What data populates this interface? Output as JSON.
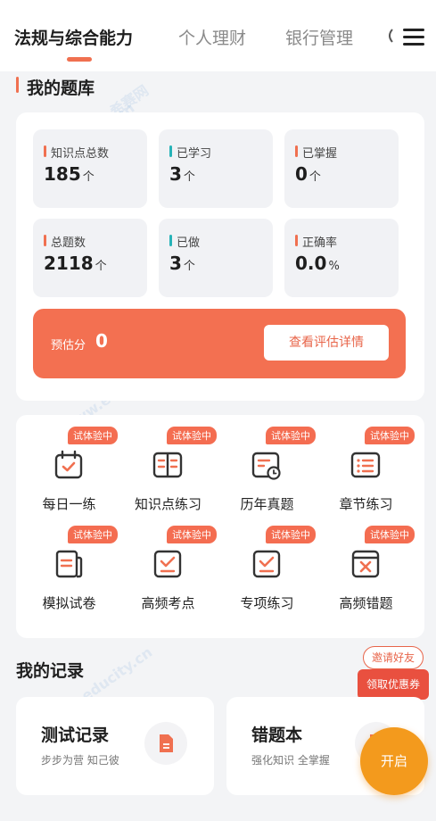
{
  "tabs": [
    {
      "label": "法规与综合能力"
    },
    {
      "label": "个人理财"
    },
    {
      "label": "银行管理"
    }
  ],
  "my_bank": {
    "title": "我的题库",
    "stats": [
      {
        "label": "知识点总数",
        "value": "185",
        "unit": "个",
        "accent": "#f07050"
      },
      {
        "label": "已学习",
        "value": "3",
        "unit": "个",
        "accent": "#27b3b8"
      },
      {
        "label": "已掌握",
        "value": "0",
        "unit": "个",
        "accent": "#f07050"
      },
      {
        "label": "总题数",
        "value": "2118",
        "unit": "个",
        "accent": "#f07050"
      },
      {
        "label": "已做",
        "value": "3",
        "unit": "个",
        "accent": "#27b3b8"
      },
      {
        "label": "正确率",
        "value": "0.0",
        "unit": "%",
        "accent": "#f07050"
      }
    ],
    "score": {
      "label": "预估分",
      "value": "0",
      "button": "查看评估详情"
    }
  },
  "features": {
    "badge": "试体验中",
    "items": [
      {
        "label": "每日一练",
        "icon": "calendar-check-icon"
      },
      {
        "label": "知识点练习",
        "icon": "book-open-icon"
      },
      {
        "label": "历年真题",
        "icon": "document-clock-icon"
      },
      {
        "label": "章节练习",
        "icon": "list-icon"
      },
      {
        "label": "模拟试卷",
        "icon": "exam-paper-icon"
      },
      {
        "label": "高频考点",
        "icon": "check-box-icon"
      },
      {
        "label": "专项练习",
        "icon": "check-box-icon"
      },
      {
        "label": "高频错题",
        "icon": "cross-box-icon"
      }
    ]
  },
  "records": {
    "title": "我的记录",
    "cards": [
      {
        "title": "测试记录",
        "subtitle": "步步为营 知己彼",
        "icon": "document-icon"
      },
      {
        "title": "错题本",
        "subtitle": "强化知识 全掌握",
        "icon": "document-icon"
      }
    ]
  },
  "invite": {
    "top": "邀请好友",
    "bottom": "领取优惠券"
  },
  "fab": {
    "label": "开启"
  },
  "watermark": {
    "text": "www.educity.cn",
    "brand": "希赛网"
  },
  "colors": {
    "accent": "#f07050",
    "teal": "#27b3b8",
    "fab": "#f39a1d"
  }
}
